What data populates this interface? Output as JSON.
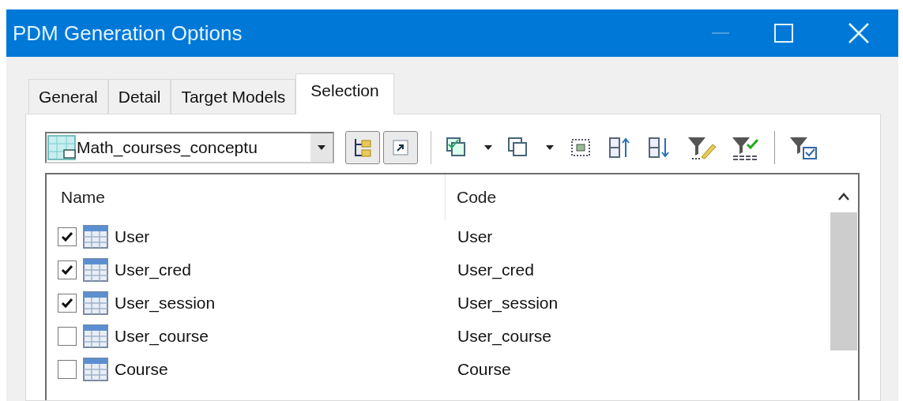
{
  "window": {
    "title": "PDM Generation Options"
  },
  "tabs": [
    {
      "label": "General",
      "selected": false
    },
    {
      "label": "Detail",
      "selected": false
    },
    {
      "label": "Target Models",
      "selected": false
    },
    {
      "label": "Selection",
      "selected": true
    }
  ],
  "model_dropdown": {
    "value": "Math_courses_conceptu"
  },
  "table": {
    "columns": [
      "Name",
      "Code"
    ],
    "rows": [
      {
        "checked": true,
        "name": "User",
        "code": "User"
      },
      {
        "checked": true,
        "name": "User_cred",
        "code": "User_cred"
      },
      {
        "checked": true,
        "name": "User_session",
        "code": "User_session"
      },
      {
        "checked": false,
        "name": "User_course",
        "code": "User_course"
      },
      {
        "checked": false,
        "name": "Course",
        "code": "Course"
      }
    ]
  }
}
